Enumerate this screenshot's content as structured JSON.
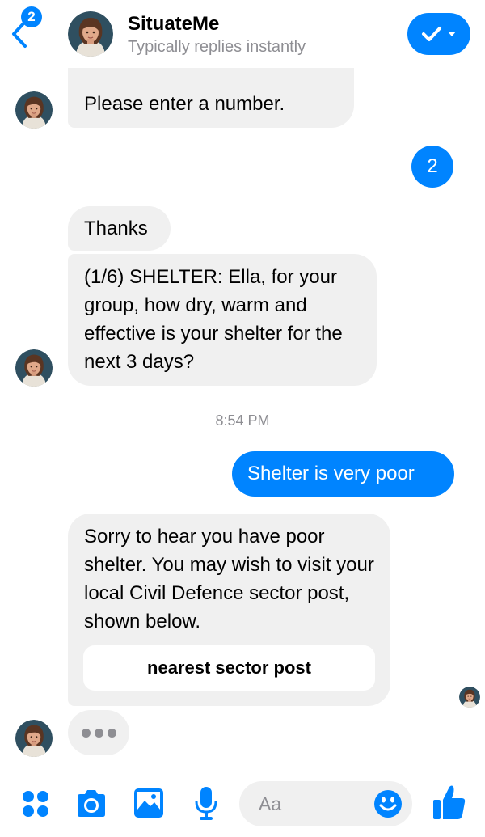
{
  "header": {
    "unread_count": "2",
    "title": "SituateMe",
    "subtitle": "Typically replies instantly"
  },
  "messages": [
    {
      "from": "bot",
      "text": "Please enter a number."
    },
    {
      "from": "user",
      "text": "2"
    },
    {
      "from": "bot",
      "text": "Thanks"
    },
    {
      "from": "bot",
      "text": "(1/6) SHELTER: Ella, for your group, how dry, warm and effective is your shelter for the next 3 days?"
    },
    {
      "from": "user",
      "text": "Shelter is very poor"
    },
    {
      "from": "bot",
      "text": "Sorry to hear you have poor shelter. You may wish to visit your local Civil Defence sector post, shown below."
    }
  ],
  "timestamp": "8:54 PM",
  "quick_reply": "nearest sector post",
  "composer": {
    "placeholder": "Aa",
    "icons": [
      "apps-icon",
      "camera-icon",
      "photo-icon",
      "microphone-icon",
      "emoji-icon",
      "thumbs-up-icon"
    ]
  },
  "colors": {
    "accent": "#0084ff",
    "incoming_bubble": "#f0f0f0",
    "muted_text": "#8e8e93"
  }
}
